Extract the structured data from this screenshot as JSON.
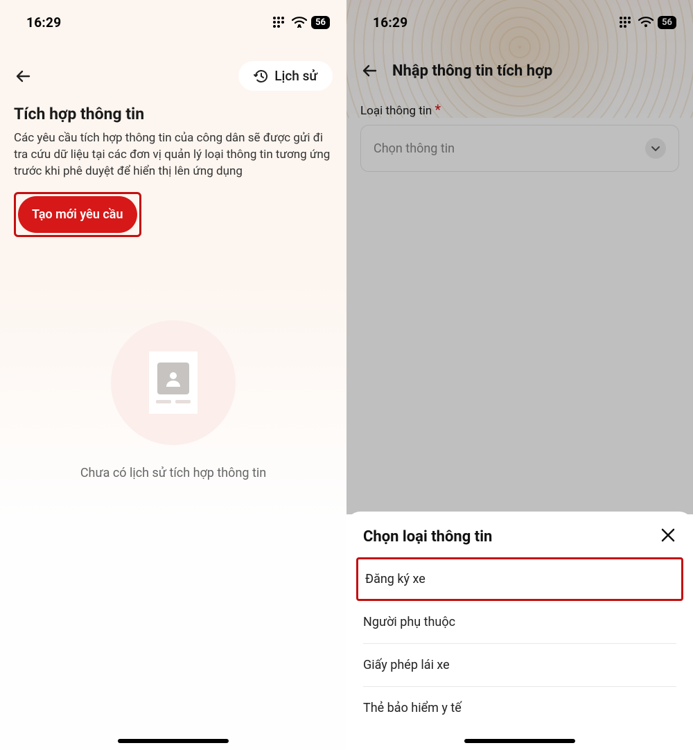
{
  "status": {
    "time": "16:29",
    "battery": "56"
  },
  "left": {
    "history_label": "Lịch sử",
    "title": "Tích hợp thông tin",
    "description": "Các yêu cầu tích hợp thông tin của công dân sẽ được gửi đi tra cứu dữ liệu tại các đơn vị quản lý loại thông tin tương ứng trước khi phê duyệt để hiển thị lên ứng dụng",
    "cta": "Tạo mới yêu cầu",
    "empty_text": "Chưa có lịch sử tích hợp thông tin"
  },
  "right": {
    "title": "Nhập thông tin tích hợp",
    "form_label": "Loại thông tin",
    "select_placeholder": "Chọn thông tin",
    "sheet_title": "Chọn loại thông tin",
    "options": [
      "Đăng ký xe",
      "Người phụ thuộc",
      "Giấy phép lái xe",
      "Thẻ bảo hiểm y tế"
    ]
  }
}
